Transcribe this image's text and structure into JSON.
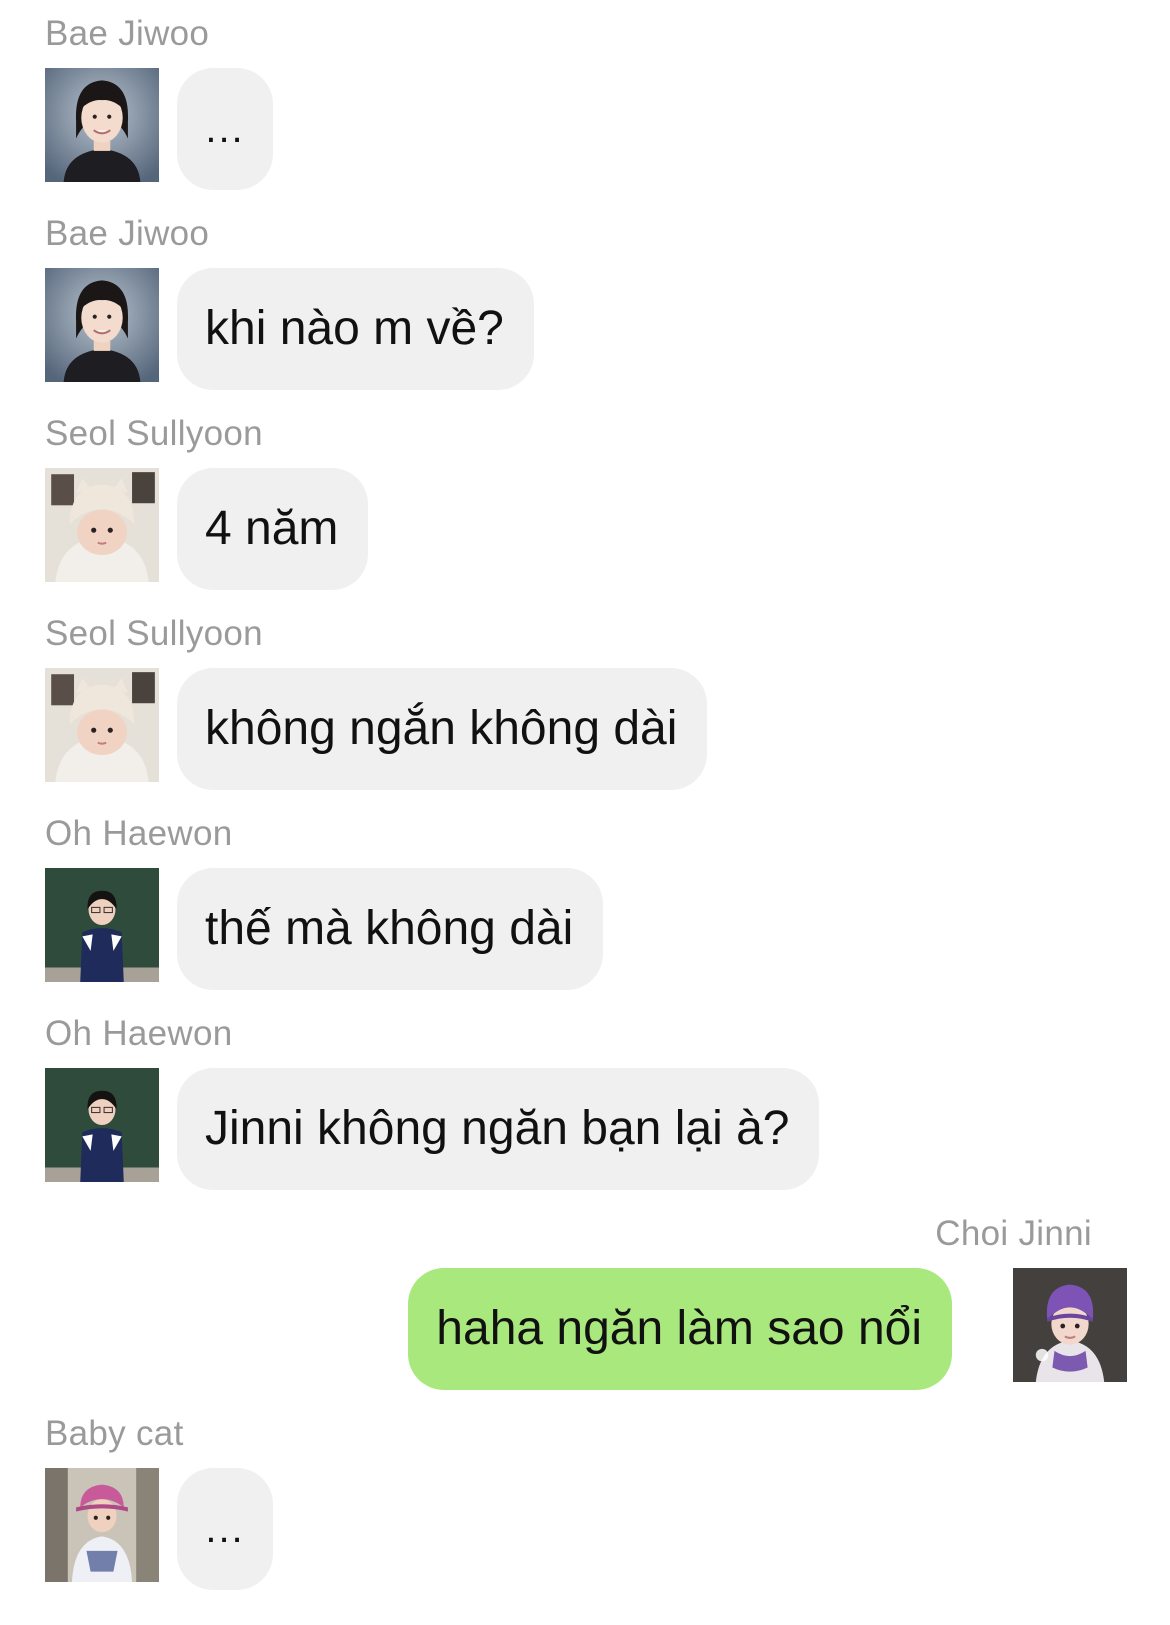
{
  "colors": {
    "incoming_bubble": "#f0f0f0",
    "outgoing_bubble": "#a9e87c",
    "sender_name": "#9a9a9a",
    "text": "#111111"
  },
  "messages": [
    {
      "sender": "Bae Jiwoo",
      "text": "...",
      "side": "left",
      "avatar": "girl-portrait-avatar"
    },
    {
      "sender": "Bae Jiwoo",
      "text": "khi nào m về?",
      "side": "left",
      "avatar": "girl-portrait-avatar"
    },
    {
      "sender": "Seol Sullyoon",
      "text": "4 năm",
      "side": "left",
      "avatar": "baby-hat-avatar"
    },
    {
      "sender": "Seol Sullyoon",
      "text": "không ngắn không dài",
      "side": "left",
      "avatar": "baby-hat-avatar"
    },
    {
      "sender": "Oh Haewon",
      "text": "thế mà không dài",
      "side": "left",
      "avatar": "child-chalkboard-avatar"
    },
    {
      "sender": "Oh Haewon",
      "text": "Jinni không ngăn bạn lại à?",
      "side": "left",
      "avatar": "child-chalkboard-avatar"
    },
    {
      "sender": "Choi Jinni",
      "text": "haha ngăn làm sao nổi",
      "side": "right",
      "avatar": "purple-beanie-avatar"
    },
    {
      "sender": "Baby cat",
      "text": "...",
      "side": "left",
      "avatar": "child-pink-hat-avatar"
    }
  ]
}
